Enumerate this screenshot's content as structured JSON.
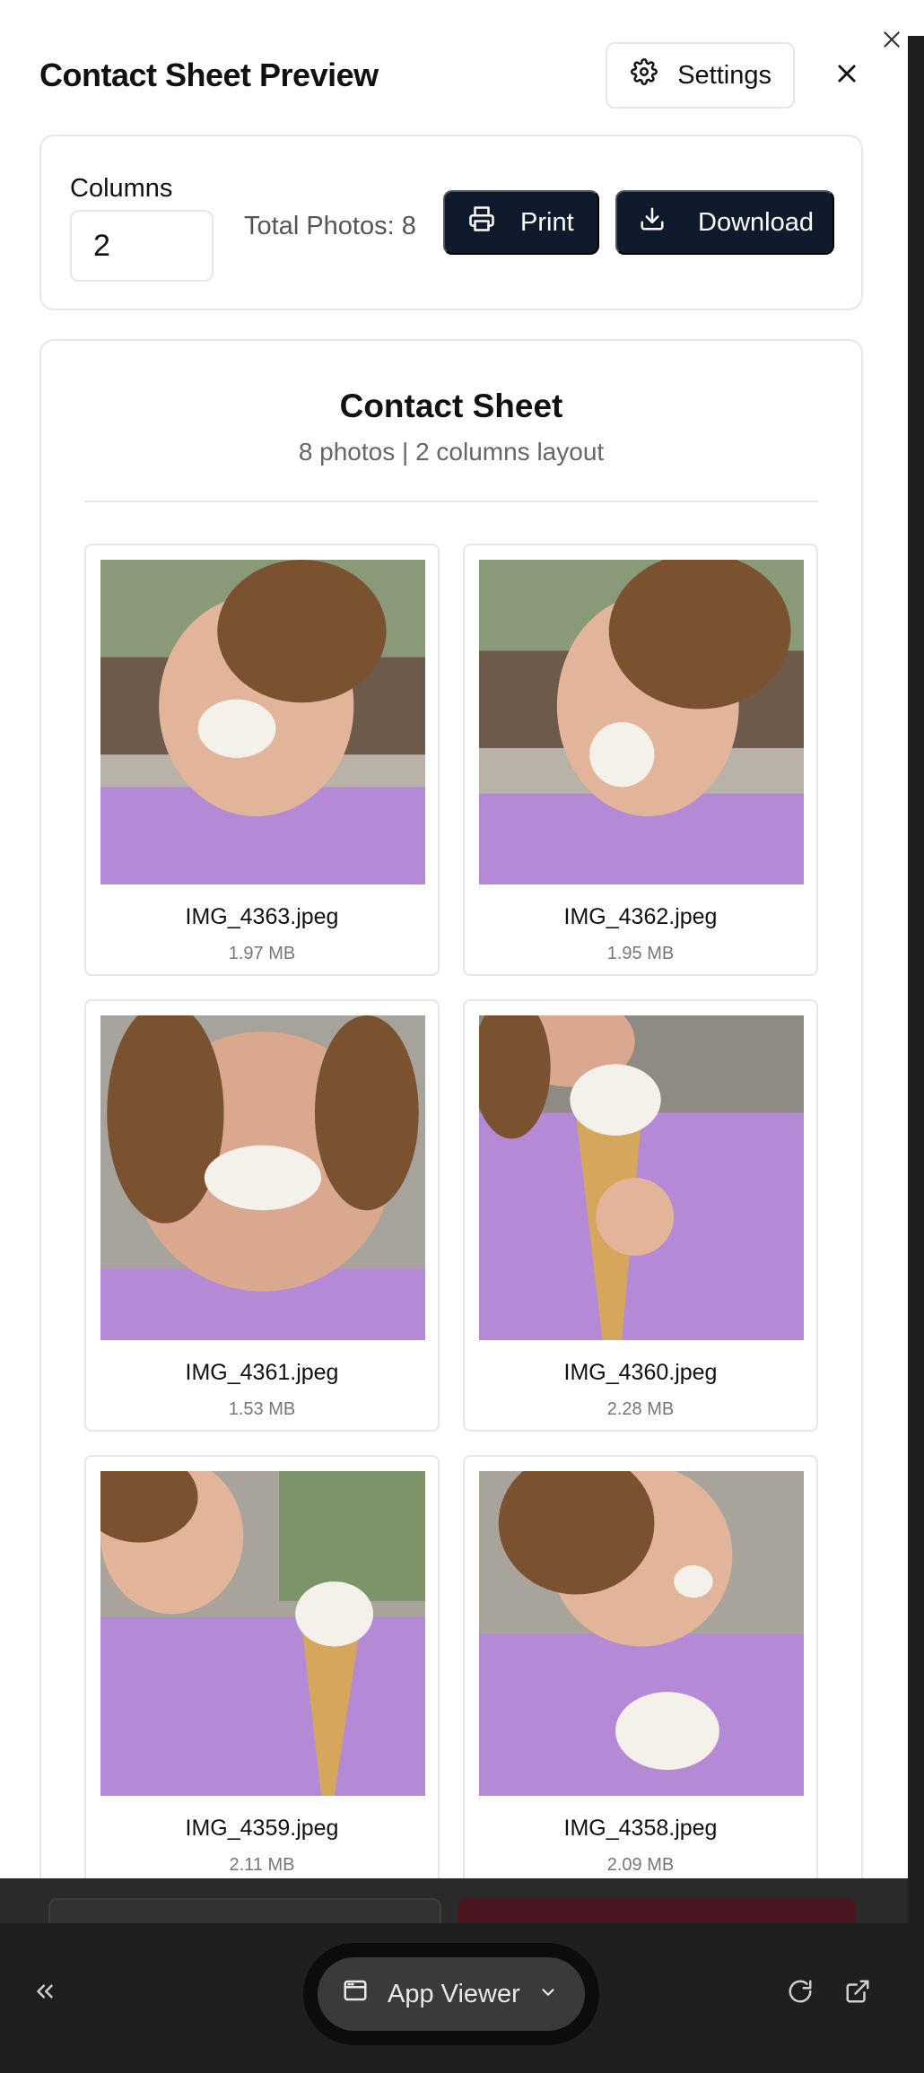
{
  "modal": {
    "title": "Contact Sheet Preview",
    "settings_label": "Settings"
  },
  "controls": {
    "columns_label": "Columns",
    "columns_value": "2",
    "total_photos": "Total Photos: 8",
    "print_label": "Print",
    "download_label": "Download"
  },
  "sheet": {
    "title": "Contact Sheet",
    "subtitle": "8 photos | 2 columns layout",
    "photos": [
      {
        "name": "IMG_4363.jpeg",
        "size": "1.97 MB"
      },
      {
        "name": "IMG_4362.jpeg",
        "size": "1.95 MB"
      },
      {
        "name": "IMG_4361.jpeg",
        "size": "1.53 MB"
      },
      {
        "name": "IMG_4360.jpeg",
        "size": "2.28 MB"
      },
      {
        "name": "IMG_4359.jpeg",
        "size": "2.11 MB"
      },
      {
        "name": "IMG_4358.jpeg",
        "size": "2.09 MB"
      }
    ]
  },
  "bottom_bar": {
    "app_viewer_label": "App Viewer"
  },
  "colors": {
    "primary_button": "#0f1a2c",
    "border": "#e5e7eb",
    "muted_text": "#666666",
    "shirt_purple": "#b48ad6"
  },
  "icons": {
    "outer_close": "close-icon",
    "settings": "gear-icon",
    "modal_close": "close-icon",
    "print": "printer-icon",
    "download": "download-icon",
    "back": "double-chevron-left-icon",
    "app": "browser-window-icon",
    "dropdown": "chevron-down-icon",
    "refresh": "refresh-icon",
    "open_external": "external-link-icon"
  }
}
